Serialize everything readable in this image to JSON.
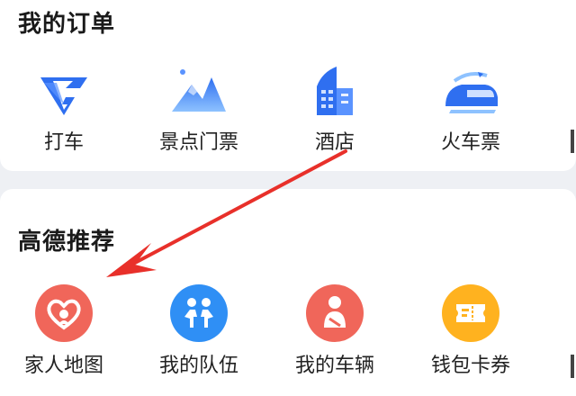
{
  "orders": {
    "title": "我的订单",
    "items": [
      {
        "label": "打车",
        "icon": "taxi-icon"
      },
      {
        "label": "景点门票",
        "icon": "mountain-icon"
      },
      {
        "label": "酒店",
        "icon": "hotel-building-icon"
      },
      {
        "label": "火车票",
        "icon": "train-icon"
      }
    ]
  },
  "recommend": {
    "title": "高德推荐",
    "items": [
      {
        "label": "家人地图",
        "icon": "family-heart-icon",
        "color": "#f0665a"
      },
      {
        "label": "我的队伍",
        "icon": "team-people-icon",
        "color": "#2f8ff5"
      },
      {
        "label": "我的车辆",
        "icon": "driver-icon",
        "color": "#f0665a"
      },
      {
        "label": "钱包卡券",
        "icon": "ticket-icon",
        "color": "#ffb21f"
      }
    ]
  },
  "colors": {
    "accent_blue": "#2f6ff0",
    "arrow_red": "#e8302a"
  }
}
